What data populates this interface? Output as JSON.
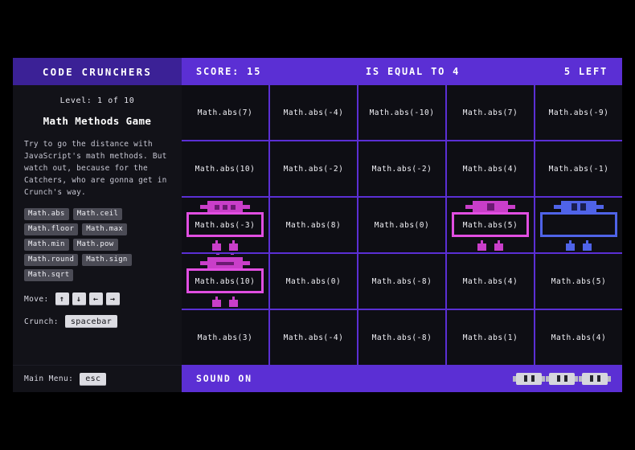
{
  "sidebar": {
    "app_title": "CODE CRUNCHERS",
    "level_text": "Level: 1 of 10",
    "game_title": "Math Methods Game",
    "description": "Try to go the distance with JavaScript's math methods. But watch out, because for the Catchers, who are gonna get in Crunch's way.",
    "methods": [
      "Math.abs",
      "Math.ceil",
      "Math.floor",
      "Math.max",
      "Math.min",
      "Math.pow",
      "Math.round",
      "Math.sign",
      "Math.sqrt"
    ],
    "move_label": "Move:",
    "move_keys": [
      "↑",
      "↓",
      "←",
      "→"
    ],
    "crunch_label": "Crunch:",
    "crunch_key": "spacebar",
    "main_menu_label": "Main Menu:",
    "main_menu_key": "esc"
  },
  "game": {
    "score_label": "SCORE: 15",
    "goal_label": "IS EQUAL TO 4",
    "lives_label": "5 LEFT",
    "sound_label": "SOUND ON",
    "lives_count": 3
  },
  "colors": {
    "sidebar_header": "#3b2196",
    "game_accent": "#5b2fd4",
    "cell_bg": "#0e0e14",
    "catcher": "#e14ee1",
    "crunch": "#4f63e8"
  },
  "grid": {
    "rows": 5,
    "cols": 5,
    "cells": [
      {
        "text": "Math.abs(7)",
        "sprite": "none"
      },
      {
        "text": "Math.abs(-4)",
        "sprite": "none"
      },
      {
        "text": "Math.abs(-10)",
        "sprite": "none"
      },
      {
        "text": "Math.abs(7)",
        "sprite": "none"
      },
      {
        "text": "Math.abs(-9)",
        "sprite": "none"
      },
      {
        "text": "Math.abs(10)",
        "sprite": "none"
      },
      {
        "text": "Math.abs(-2)",
        "sprite": "none"
      },
      {
        "text": "Math.abs(-2)",
        "sprite": "none"
      },
      {
        "text": "Math.abs(4)",
        "sprite": "none"
      },
      {
        "text": "Math.abs(-1)",
        "sprite": "none"
      },
      {
        "text": "Math.abs(-3)",
        "sprite": "catcher-three-eye"
      },
      {
        "text": "Math.abs(8)",
        "sprite": "none"
      },
      {
        "text": "Math.abs(0)",
        "sprite": "none"
      },
      {
        "text": "Math.abs(5)",
        "sprite": "catcher-one-eye"
      },
      {
        "text": "",
        "sprite": "crunch"
      },
      {
        "text": "Math.abs(10)",
        "sprite": "catcher-mouth"
      },
      {
        "text": "Math.abs(0)",
        "sprite": "none"
      },
      {
        "text": "Math.abs(-8)",
        "sprite": "none"
      },
      {
        "text": "Math.abs(4)",
        "sprite": "none"
      },
      {
        "text": "Math.abs(5)",
        "sprite": "none"
      },
      {
        "text": "Math.abs(3)",
        "sprite": "none"
      },
      {
        "text": "Math.abs(-4)",
        "sprite": "none"
      },
      {
        "text": "Math.abs(-8)",
        "sprite": "none"
      },
      {
        "text": "Math.abs(1)",
        "sprite": "none"
      },
      {
        "text": "Math.abs(4)",
        "sprite": "none"
      }
    ]
  }
}
